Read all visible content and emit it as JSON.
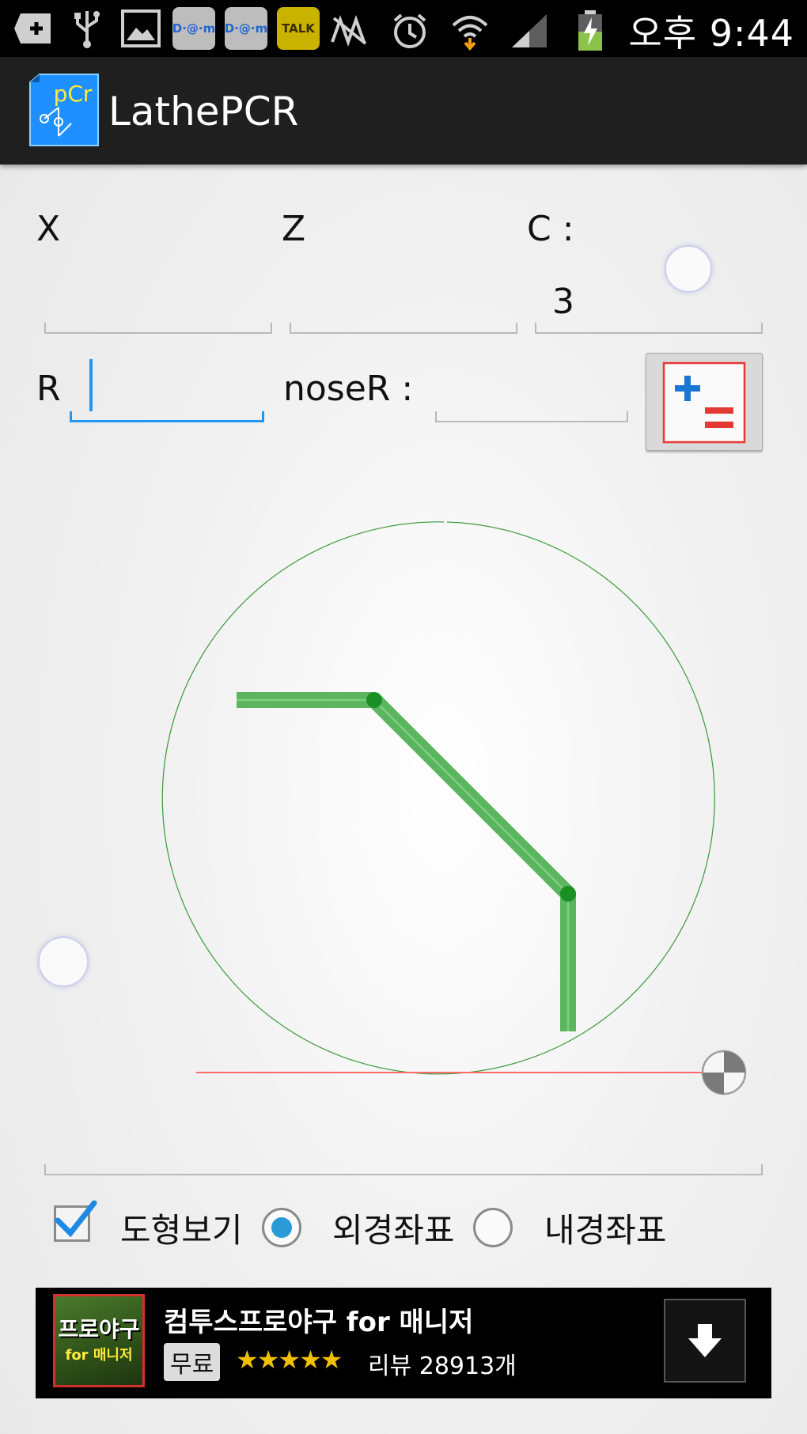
{
  "status_bar": {
    "time": "오후 9:44",
    "left_icons": [
      "add-icon",
      "usb-icon",
      "gallery-icon",
      "daum-icon",
      "daum-icon",
      "kakaotalk-icon"
    ],
    "daum_label": "D·@·m",
    "talk_label": "TALK",
    "right_icons": [
      "no-signal-icon",
      "alarm-icon",
      "wifi-icon",
      "cell-signal-icon",
      "battery-charging-icon"
    ]
  },
  "app_bar": {
    "title": "LathePCR",
    "logo_text": "pCr"
  },
  "inputs": {
    "x_label": "X",
    "z_label": "Z",
    "c_label": "C :",
    "c_value": "3",
    "r_label": "R",
    "nose_label": "noseR :"
  },
  "options": {
    "show_shape_label": "도형보기",
    "show_shape_checked": true,
    "outer_coord_label": "외경좌표",
    "inner_coord_label": "내경좌표",
    "selected": "외경좌표"
  },
  "ad": {
    "title": "컴투스프로야구 for 매니저",
    "price": "무료",
    "stars": "★★★★★",
    "rating": 4.5,
    "reviews": "리뷰 28913개",
    "thumb_text": "프로야구",
    "thumb_sub": "for 매니저"
  },
  "colors": {
    "accent_blue": "#2196f3",
    "shape_green": "#4caf50",
    "axis_red": "#ff6b6b",
    "circle_green": "#3a9a3a"
  }
}
